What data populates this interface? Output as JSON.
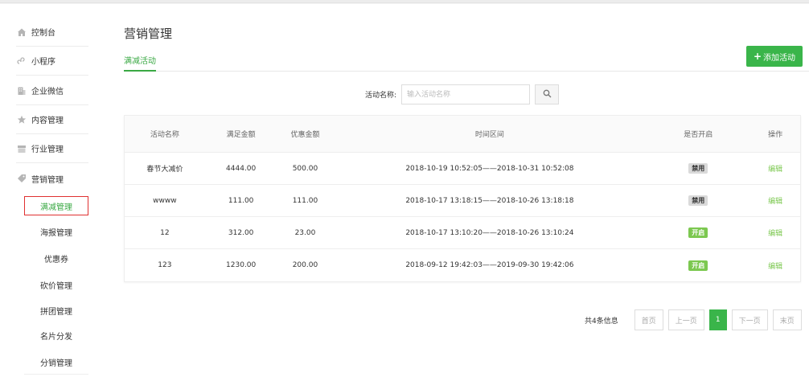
{
  "sidebar": {
    "items": [
      {
        "label": "控制台",
        "icon": "home-icon"
      },
      {
        "label": "小程序",
        "icon": "link-icon"
      },
      {
        "label": "企业微信",
        "icon": "building-icon"
      },
      {
        "label": "内容管理",
        "icon": "star-icon"
      },
      {
        "label": "行业管理",
        "icon": "store-icon"
      },
      {
        "label": "营销管理",
        "icon": "tag-icon"
      }
    ],
    "sub_items": [
      {
        "label": "满减管理",
        "active": true
      },
      {
        "label": "海报管理"
      },
      {
        "label": "优惠券"
      },
      {
        "label": "砍价管理"
      },
      {
        "label": "拼团管理"
      },
      {
        "label": "名片分发"
      },
      {
        "label": "分销管理"
      }
    ]
  },
  "main": {
    "title": "营销管理",
    "tab": "满减活动",
    "add_button": "添加活动",
    "search": {
      "label": "活动名称:",
      "placeholder": "输入活动名称"
    }
  },
  "table": {
    "headers": [
      "活动名称",
      "满足金额",
      "优惠金额",
      "时间区间",
      "是否开启",
      "操作"
    ],
    "rows": [
      {
        "name": "春节大减价",
        "threshold": "4444.00",
        "discount": "500.00",
        "period": "2018-10-19 10:52:05——2018-10-31 10:52:08",
        "status": "禁用",
        "enabled": false,
        "action": "编辑"
      },
      {
        "name": "wwww",
        "threshold": "111.00",
        "discount": "111.00",
        "period": "2018-10-17 13:18:15——2018-10-26 13:18:18",
        "status": "禁用",
        "enabled": false,
        "action": "编辑"
      },
      {
        "name": "12",
        "threshold": "312.00",
        "discount": "23.00",
        "period": "2018-10-17 13:10:20——2018-10-26 13:10:24",
        "status": "开启",
        "enabled": true,
        "action": "编辑"
      },
      {
        "name": "123",
        "threshold": "1230.00",
        "discount": "200.00",
        "period": "2018-09-12 19:42:03——2019-09-30 19:42:06",
        "status": "开启",
        "enabled": true,
        "action": "编辑"
      }
    ]
  },
  "pagination": {
    "total": "共4条信息",
    "first": "首页",
    "prev": "上一页",
    "current": "1",
    "next": "下一页",
    "last": "末页"
  },
  "colors": {
    "accent": "#3ab54a",
    "active_outline": "#e03131",
    "enabled_badge": "#7cc850"
  }
}
